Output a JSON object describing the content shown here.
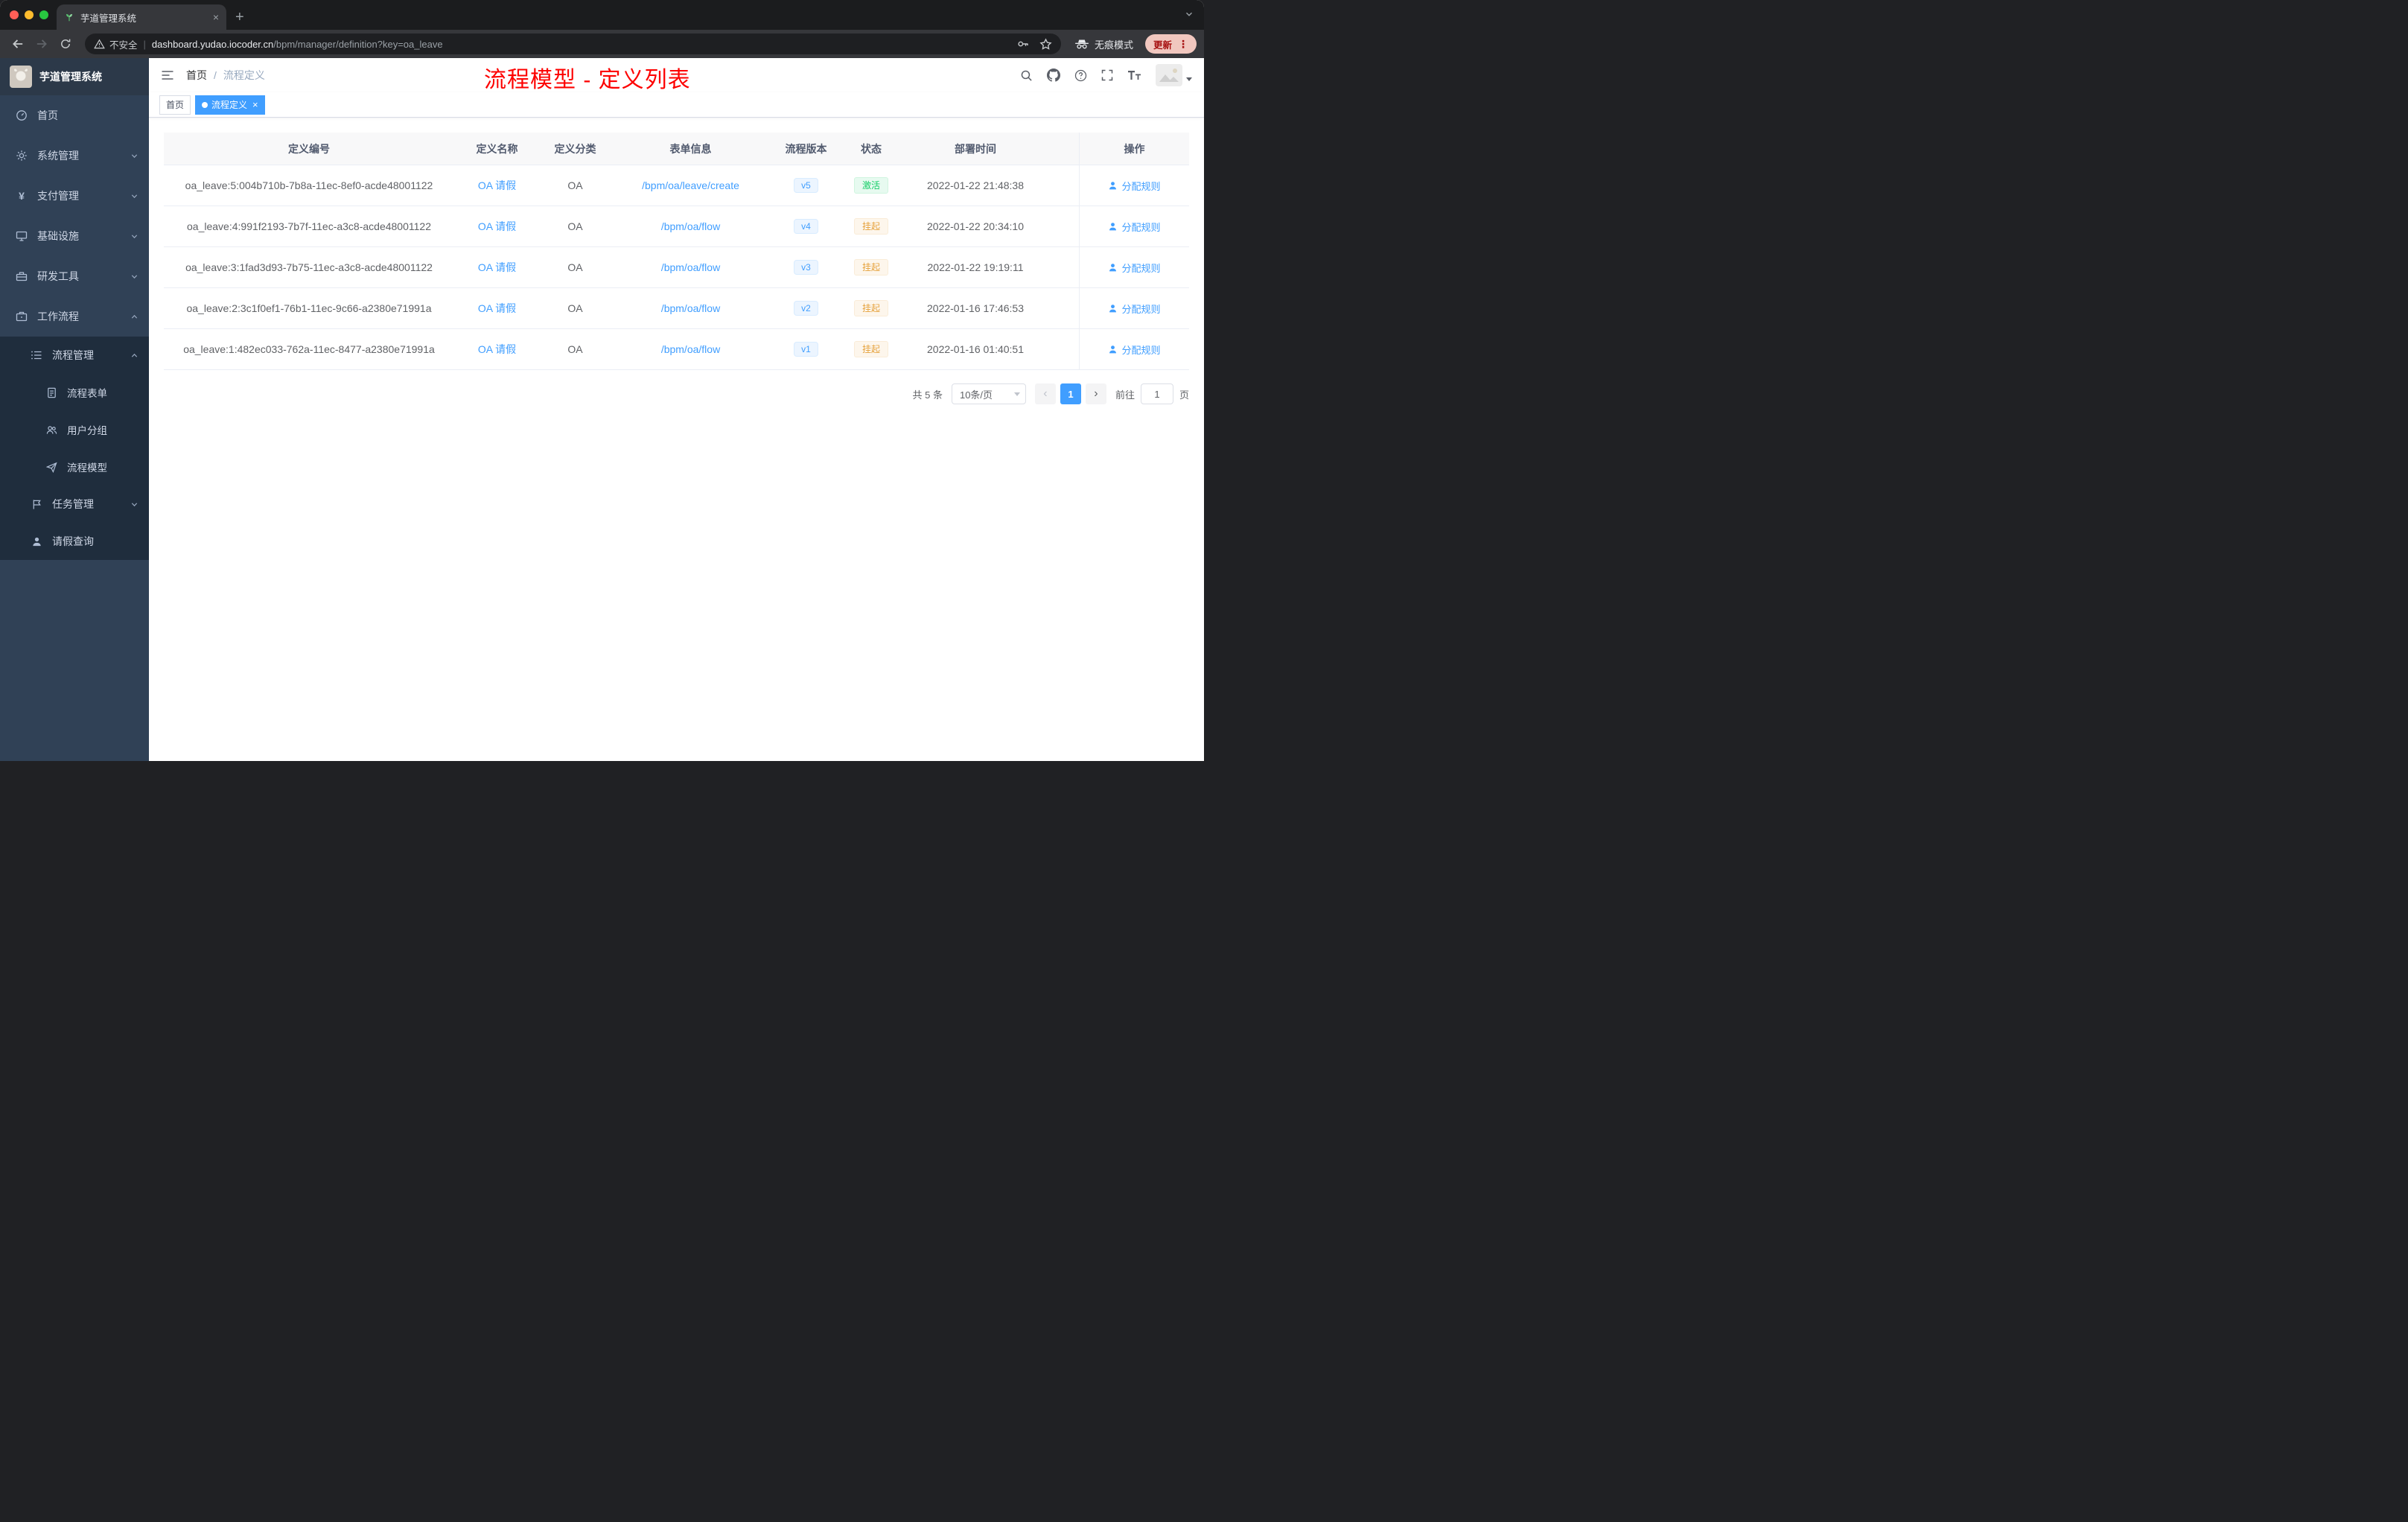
{
  "browser": {
    "tab": {
      "title": "芋道管理系统"
    },
    "nav": {
      "security_label": "不安全",
      "url_host": "dashboard.yudao.iocoder.cn",
      "url_path": "/bpm/manager/definition?key=oa_leave",
      "incognito_label": "无痕模式",
      "update_label": "更新"
    }
  },
  "sidebar": {
    "logo_title": "芋道管理系统",
    "items": [
      {
        "label": "首页",
        "icon": "dashboard-icon"
      },
      {
        "label": "系统管理",
        "icon": "gear-icon"
      },
      {
        "label": "支付管理",
        "icon": "yen-icon"
      },
      {
        "label": "基础设施",
        "icon": "monitor-icon"
      },
      {
        "label": "研发工具",
        "icon": "toolbox-icon"
      },
      {
        "label": "工作流程",
        "icon": "briefcase-icon"
      }
    ],
    "submenu": {
      "group_label": "流程管理",
      "children": [
        {
          "label": "流程表单",
          "icon": "document-icon"
        },
        {
          "label": "用户分组",
          "icon": "users-icon"
        },
        {
          "label": "流程模型",
          "icon": "send-icon"
        }
      ],
      "task_label": "任务管理",
      "leave_label": "请假查询"
    }
  },
  "header": {
    "breadcrumb_home": "首页",
    "breadcrumb_current": "流程定义",
    "annotation": "流程模型 - 定义列表"
  },
  "tags": {
    "home": "首页",
    "active": "流程定义"
  },
  "table": {
    "headers": [
      "定义编号",
      "定义名称",
      "定义分类",
      "表单信息",
      "流程版本",
      "状态",
      "部署时间",
      "操作"
    ],
    "action_label": "分配规则",
    "rows": [
      {
        "id": "oa_leave:5:004b710b-7b8a-11ec-8ef0-acde48001122",
        "name": "OA 请假",
        "category": "OA",
        "form": "/bpm/oa/leave/create",
        "version": "v5",
        "status": "激活",
        "status_type": "success",
        "deployed_at": "2022-01-22 21:48:38"
      },
      {
        "id": "oa_leave:4:991f2193-7b7f-11ec-a3c8-acde48001122",
        "name": "OA 请假",
        "category": "OA",
        "form": "/bpm/oa/flow",
        "version": "v4",
        "status": "挂起",
        "status_type": "warning",
        "deployed_at": "2022-01-22 20:34:10"
      },
      {
        "id": "oa_leave:3:1fad3d93-7b75-11ec-a3c8-acde48001122",
        "name": "OA 请假",
        "category": "OA",
        "form": "/bpm/oa/flow",
        "version": "v3",
        "status": "挂起",
        "status_type": "warning",
        "deployed_at": "2022-01-22 19:19:11"
      },
      {
        "id": "oa_leave:2:3c1f0ef1-76b1-11ec-9c66-a2380e71991a",
        "name": "OA 请假",
        "category": "OA",
        "form": "/bpm/oa/flow",
        "version": "v2",
        "status": "挂起",
        "status_type": "warning",
        "deployed_at": "2022-01-16 17:46:53"
      },
      {
        "id": "oa_leave:1:482ec033-762a-11ec-8477-a2380e71991a",
        "name": "OA 请假",
        "category": "OA",
        "form": "/bpm/oa/flow",
        "version": "v1",
        "status": "挂起",
        "status_type": "warning",
        "deployed_at": "2022-01-16 01:40:51"
      }
    ]
  },
  "pagination": {
    "total": "共 5 条",
    "page_size": "10条/页",
    "current_page": "1",
    "goto_label": "前往",
    "goto_value": "1",
    "goto_unit": "页"
  },
  "colors": {
    "accent_blue": "#409eff",
    "success_green": "#13ce66",
    "warning_orange": "#e6a23c",
    "annotation_red": "#fd0100",
    "sidebar_bg": "#304156",
    "submenu_bg": "#1f2d3d"
  },
  "icons": [
    "back-arrow",
    "forward-arrow",
    "reload",
    "warning-triangle",
    "key",
    "star",
    "incognito-spy",
    "search",
    "github",
    "help",
    "fullscreen",
    "font-size",
    "hamburger",
    "dashboard",
    "gear",
    "yen",
    "monitor",
    "toolbox",
    "briefcase",
    "list",
    "document",
    "users",
    "send",
    "flag",
    "user",
    "chevron",
    "close",
    "plus"
  ]
}
